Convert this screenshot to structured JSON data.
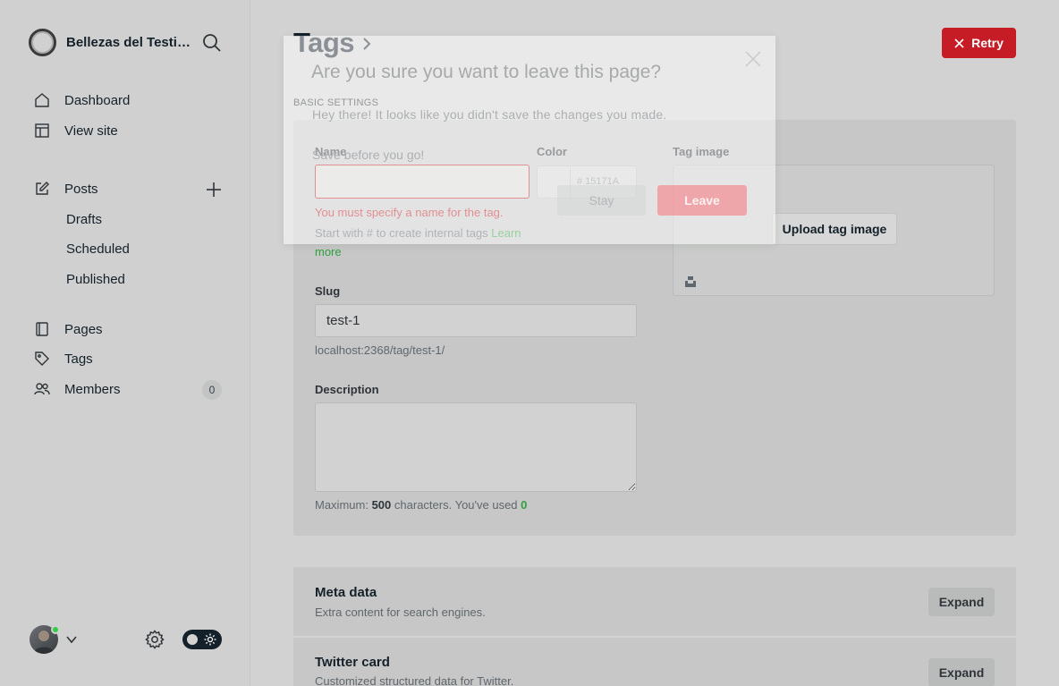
{
  "sidebar": {
    "site_name": "Bellezas del Testing",
    "nav": {
      "dashboard": "Dashboard",
      "view_site": "View site",
      "posts": "Posts",
      "drafts": "Drafts",
      "scheduled": "Scheduled",
      "published": "Published",
      "pages": "Pages",
      "tags": "Tags",
      "members": "Members",
      "members_count": "0"
    },
    "online_color": "#30cf43"
  },
  "header": {
    "title": "Tags",
    "retry_label": "Retry",
    "section_label": "BASIC SETTINGS"
  },
  "form": {
    "name_label": "Name",
    "name_value": "",
    "name_error": "You must specify a name for the tag.",
    "name_hint": "Start with # to create internal tags",
    "name_hint_link_1": "Learn",
    "name_hint_link_2": "more",
    "color_label": "Color",
    "color_hash": "#",
    "color_value": "15171A",
    "tag_image_label": "Tag image",
    "upload_label": "Upload tag image",
    "slug_label": "Slug",
    "slug_value": "test-1",
    "slug_url": "localhost:2368/tag/test-1/",
    "description_label": "Description",
    "counter_prefix": "Maximum:",
    "counter_max": "500",
    "counter_mid": "characters. You've used",
    "counter_used": "0"
  },
  "sections": [
    {
      "title": "Meta data",
      "subtitle": "Extra content for search engines.",
      "button": "Expand"
    },
    {
      "title": "Twitter card",
      "subtitle": "Customized structured data for Twitter.",
      "button": "Expand"
    }
  ],
  "modal": {
    "title": "Are you sure you want to leave this page?",
    "text_1": "Hey there! It looks like you didn't save the changes you made.",
    "text_2": "Save before you go!",
    "stay_label": "Stay",
    "leave_label": "Leave"
  },
  "colors": {
    "accent_red": "#c51c25",
    "success_green": "#30a140"
  },
  "icons": [
    "logo-icon",
    "search-icon",
    "home-icon",
    "layout-icon",
    "edit-icon",
    "plus-icon",
    "page-icon",
    "tag-icon",
    "members-icon",
    "chevron-down-icon",
    "gear-icon",
    "sun-icon",
    "chevron-right-icon",
    "close-icon",
    "unsplash-icon"
  ]
}
